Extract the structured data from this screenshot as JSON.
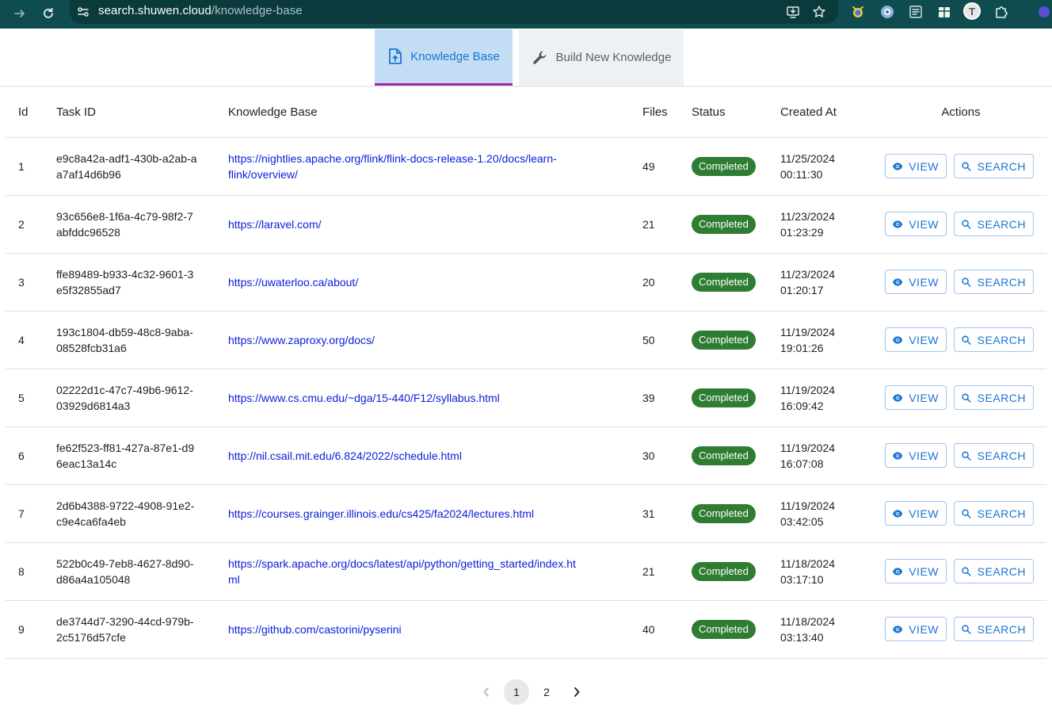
{
  "browser": {
    "url_host": "search.shuwen.cloud",
    "url_path": "/knowledge-base",
    "avatar_letter": "T"
  },
  "tabs": [
    {
      "label": "Knowledge Base",
      "icon": "upload-file-icon",
      "active": true
    },
    {
      "label": "Build New Knowledge",
      "icon": "wrench-icon",
      "active": false
    }
  ],
  "table": {
    "headers": {
      "id": "Id",
      "task_id": "Task ID",
      "knowledge_base": "Knowledge Base",
      "files": "Files",
      "status": "Status",
      "created_at": "Created At",
      "actions": "Actions"
    },
    "rows": [
      {
        "id": "1",
        "task_id": "e9c8a42a-adf1-430b-a2ab-aa7af14d6b96",
        "url": "https://nightlies.apache.org/flink/flink-docs-release-1.20/docs/learn-flink/overview/",
        "files": "49",
        "status": "Completed",
        "date": "11/25/2024",
        "time": "00:11:30"
      },
      {
        "id": "2",
        "task_id": "93c656e8-1f6a-4c79-98f2-7abfddc96528",
        "url": "https://laravel.com/",
        "files": "21",
        "status": "Completed",
        "date": "11/23/2024",
        "time": "01:23:29"
      },
      {
        "id": "3",
        "task_id": "ffe89489-b933-4c32-9601-3e5f32855ad7",
        "url": "https://uwaterloo.ca/about/",
        "files": "20",
        "status": "Completed",
        "date": "11/23/2024",
        "time": "01:20:17"
      },
      {
        "id": "4",
        "task_id": "193c1804-db59-48c8-9aba-08528fcb31a6",
        "url": "https://www.zaproxy.org/docs/",
        "files": "50",
        "status": "Completed",
        "date": "11/19/2024",
        "time": "19:01:26"
      },
      {
        "id": "5",
        "task_id": "02222d1c-47c7-49b6-9612-03929d6814a3",
        "url": "https://www.cs.cmu.edu/~dga/15-440/F12/syllabus.html",
        "files": "39",
        "status": "Completed",
        "date": "11/19/2024",
        "time": "16:09:42"
      },
      {
        "id": "6",
        "task_id": "fe62f523-ff81-427a-87e1-d96eac13a14c",
        "url": "http://nil.csail.mit.edu/6.824/2022/schedule.html",
        "files": "30",
        "status": "Completed",
        "date": "11/19/2024",
        "time": "16:07:08"
      },
      {
        "id": "7",
        "task_id": "2d6b4388-9722-4908-91e2-c9e4ca6fa4eb",
        "url": "https://courses.grainger.illinois.edu/cs425/fa2024/lectures.html",
        "files": "31",
        "status": "Completed",
        "date": "11/19/2024",
        "time": "03:42:05"
      },
      {
        "id": "8",
        "task_id": "522b0c49-7eb8-4627-8d90-d86a4a105048",
        "url": "https://spark.apache.org/docs/latest/api/python/getting_started/index.html",
        "files": "21",
        "status": "Completed",
        "date": "11/18/2024",
        "time": "03:17:10"
      },
      {
        "id": "9",
        "task_id": "de3744d7-3290-44cd-979b-2c5176d57cfe",
        "url": "https://github.com/castorini/pyserini",
        "files": "40",
        "status": "Completed",
        "date": "11/18/2024",
        "time": "03:13:40"
      }
    ],
    "view_label": "VIEW",
    "search_label": "SEARCH"
  },
  "pagination": {
    "pages": [
      "1",
      "2"
    ],
    "current": "1"
  },
  "colors": {
    "browser_bar": "#0f4c4f",
    "active_tab_bg": "#c2ddf4",
    "active_tab_indicator": "#9c27b0",
    "primary": "#1976d2",
    "status_completed": "#2e7d32",
    "link": "#0b20d9"
  }
}
